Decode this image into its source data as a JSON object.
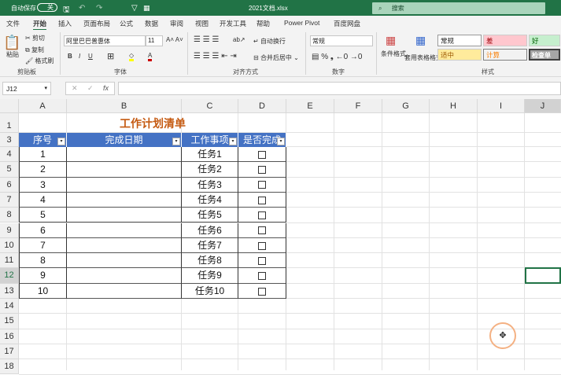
{
  "titlebar": {
    "autosave": "自动保存",
    "toggle": "关",
    "filename": "2021文档.xlsx",
    "search": "搜索"
  },
  "tabs": [
    "文件",
    "开始",
    "插入",
    "页面布局",
    "公式",
    "数据",
    "审阅",
    "视图",
    "开发工具",
    "帮助",
    "Power Pivot",
    "百度网盘"
  ],
  "ribbon": {
    "clipboard": {
      "paste": "粘贴",
      "cut": "剪切",
      "copy": "复制",
      "format_painter": "格式刷",
      "label": "剪贴板"
    },
    "font": {
      "name": "阿里巴巴普惠体",
      "size": "11",
      "label": "字体"
    },
    "align": {
      "wrap": "自动换行",
      "merge": "合并后居中",
      "label": "对齐方式"
    },
    "number": {
      "format": "常规",
      "label": "数字"
    },
    "styles": {
      "cond": "条件格式",
      "table": "套用表格格式",
      "cells": [
        "常规",
        "差",
        "好",
        "适中",
        "计算",
        "检查单"
      ],
      "label": "样式"
    }
  },
  "formula": {
    "namebox": "J12",
    "value": ""
  },
  "columns": [
    "A",
    "B",
    "C",
    "D",
    "E",
    "F",
    "G",
    "H",
    "I",
    "J"
  ],
  "rows": [
    "1",
    "3",
    "4",
    "5",
    "6",
    "7",
    "8",
    "9",
    "10",
    "11",
    "12",
    "13",
    "14",
    "15",
    "16",
    "17",
    "18"
  ],
  "sheet": {
    "title": "工作计划清单",
    "headers": [
      "序号",
      "完成日期",
      "工作事项",
      "是否完成"
    ],
    "data": [
      [
        "1",
        "",
        "任务1",
        ""
      ],
      [
        "2",
        "",
        "任务2",
        ""
      ],
      [
        "3",
        "",
        "任务3",
        ""
      ],
      [
        "4",
        "",
        "任务4",
        ""
      ],
      [
        "5",
        "",
        "任务5",
        ""
      ],
      [
        "6",
        "",
        "任务6",
        ""
      ],
      [
        "7",
        "",
        "任务7",
        ""
      ],
      [
        "8",
        "",
        "任务8",
        ""
      ],
      [
        "9",
        "",
        "任务9",
        ""
      ],
      [
        "10",
        "",
        "任务10",
        ""
      ]
    ]
  },
  "colors": {
    "excel_green": "#217346",
    "table_header": "#4472c4",
    "title": "#c55a11"
  }
}
